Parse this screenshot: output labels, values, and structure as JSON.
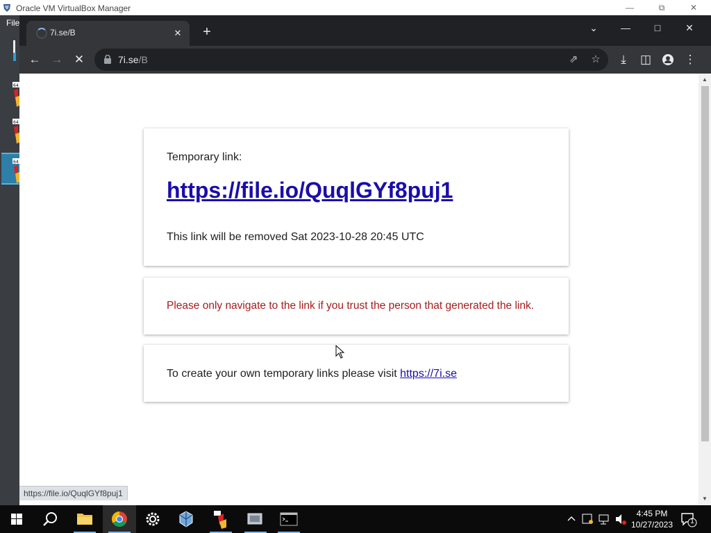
{
  "vbox": {
    "title": "Oracle VM VirtualBox Manager",
    "file_menu": "File",
    "vm_badge": "64"
  },
  "browser": {
    "tab_title": "7i.se/B",
    "address": {
      "host": "7i.se",
      "path": "/B"
    }
  },
  "page": {
    "temporary_label": "Temporary link:",
    "temporary_url": "https://file.io/QuqlGYf8puj1",
    "expiry_text": "This link will be removed Sat 2023-10-28 20:45 UTC",
    "warning_text": "Please only navigate to the link if you trust the person that generated the link.",
    "create_text": "To create your own temporary links please visit ",
    "create_link": "https://7i.se"
  },
  "status_bar": {
    "hover_url": "https://file.io/QuqlGYf8puj1"
  },
  "taskbar": {
    "time": "4:45 PM",
    "date": "10/27/2023",
    "notification_count": "1"
  },
  "colors": {
    "link": "#1a0dab",
    "warning": "#a61b1b",
    "chrome_dark": "#202124",
    "chrome_toolbar": "#35363a"
  }
}
